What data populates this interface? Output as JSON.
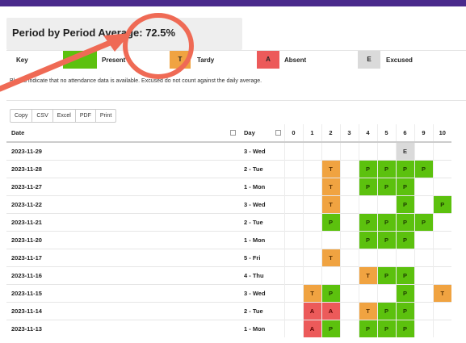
{
  "header": {
    "average_text": "Period by Period Average: 72.5%"
  },
  "key": {
    "label": "Key",
    "items": [
      {
        "code": "",
        "text": "Present",
        "color": "#5cc10e"
      },
      {
        "code": "T",
        "text": "Tardy",
        "color": "#f0a341"
      },
      {
        "code": "A",
        "text": "Absent",
        "color": "#ec5a5a"
      },
      {
        "code": "E",
        "text": "Excused",
        "color": "#dadada"
      }
    ]
  },
  "note": "Blanks indicate that no attendance data is available. Excused do not count against the daily average.",
  "toolbar": [
    "Copy",
    "CSV",
    "Excel",
    "PDF",
    "Print"
  ],
  "table": {
    "headers": {
      "date": "Date",
      "day": "Day"
    },
    "periods": [
      "0",
      "1",
      "2",
      "3",
      "4",
      "5",
      "6",
      "9",
      "10"
    ],
    "rows": [
      {
        "date": "2023-11-29",
        "day": "3 - Wed",
        "cells": [
          "",
          "",
          "",
          "",
          "",
          "",
          "E",
          "",
          ""
        ]
      },
      {
        "date": "2023-11-28",
        "day": "2 - Tue",
        "cells": [
          "",
          "",
          "T",
          "",
          "P",
          "P",
          "P",
          "P",
          ""
        ]
      },
      {
        "date": "2023-11-27",
        "day": "1 - Mon",
        "cells": [
          "",
          "",
          "T",
          "",
          "P",
          "P",
          "P",
          "",
          ""
        ]
      },
      {
        "date": "2023-11-22",
        "day": "3 - Wed",
        "cells": [
          "",
          "",
          "T",
          "",
          "",
          "",
          "P",
          "",
          "P"
        ]
      },
      {
        "date": "2023-11-21",
        "day": "2 - Tue",
        "cells": [
          "",
          "",
          "P",
          "",
          "P",
          "P",
          "P",
          "P",
          ""
        ]
      },
      {
        "date": "2023-11-20",
        "day": "1 - Mon",
        "cells": [
          "",
          "",
          "",
          "",
          "P",
          "P",
          "P",
          "",
          ""
        ]
      },
      {
        "date": "2023-11-17",
        "day": "5 - Fri",
        "cells": [
          "",
          "",
          "T",
          "",
          "",
          "",
          "",
          "",
          ""
        ]
      },
      {
        "date": "2023-11-16",
        "day": "4 - Thu",
        "cells": [
          "",
          "",
          "",
          "",
          "T",
          "P",
          "P",
          "",
          ""
        ]
      },
      {
        "date": "2023-11-15",
        "day": "3 - Wed",
        "cells": [
          "",
          "T",
          "P",
          "",
          "",
          "",
          "P",
          "",
          "T"
        ]
      },
      {
        "date": "2023-11-14",
        "day": "2 - Tue",
        "cells": [
          "",
          "A",
          "A",
          "",
          "T",
          "P",
          "P",
          "",
          ""
        ]
      },
      {
        "date": "2023-11-13",
        "day": "1 - Mon",
        "cells": [
          "",
          "A",
          "P",
          "",
          "P",
          "P",
          "P",
          "",
          ""
        ]
      }
    ]
  },
  "annotation": {
    "color": "#ef6a55"
  }
}
